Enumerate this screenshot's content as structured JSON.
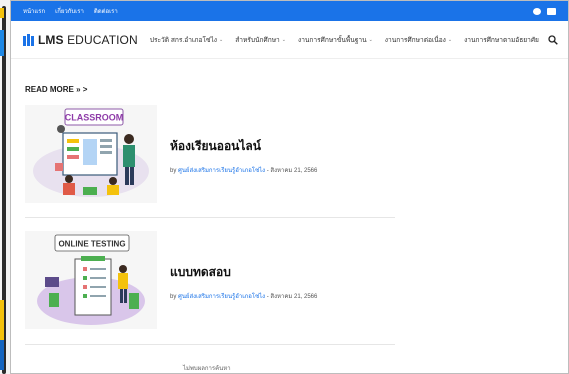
{
  "topbar": {
    "links": [
      "หน้าแรก",
      "เกี่ยวกับเรา",
      "ติดต่อเรา"
    ],
    "accent": "#1a73e8"
  },
  "nav": {
    "logo_bold": "LMS",
    "logo_rest": " EDUCATION",
    "menu": [
      "ประวัติ สกร.อำเภอโซ่ไง",
      "สำหรับนักศึกษา",
      "งานการศึกษาขั้นพื้นฐาน",
      "งานการศึกษาต่อเนื่อง",
      "งานการศึกษาตามอัธยาศัย"
    ]
  },
  "section": {
    "read_more": "READ MORE » >"
  },
  "posts": [
    {
      "thumb_label": "CLASSROOM",
      "title": "ห้องเรียนออนไลน์",
      "by": "by ",
      "author": "ศูนย์ส่งเสริมการเรียนรู้อำเภอโซ่ไง",
      "date": " - สิงหาคม 21, 2566"
    },
    {
      "thumb_label": "ONLINE TESTING",
      "title": "แบบทดสอบ",
      "by": "by ",
      "author": "ศูนย์ส่งเสริมการเรียนรู้อำเภอโซ่ไง",
      "date": " - สิงหาคม 21, 2566"
    }
  ],
  "footer": {
    "text": "ไม่พบผลการค้นหา"
  }
}
